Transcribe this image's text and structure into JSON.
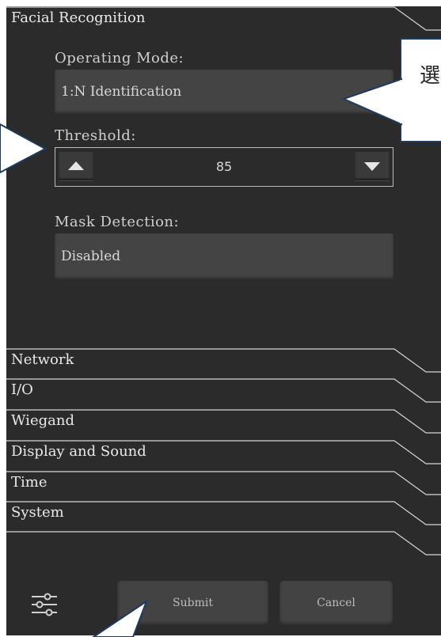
{
  "facial_recognition": {
    "title": "Facial Recognition",
    "operating_mode": {
      "label": "Operating Mode:",
      "value": "1:N Identification"
    },
    "threshold": {
      "label": "Threshold:",
      "value": "85"
    },
    "mask_detection": {
      "label": "Mask Detection:",
      "value": "Disabled"
    }
  },
  "sections": [
    {
      "label": "Network"
    },
    {
      "label": "I/O"
    },
    {
      "label": "Wiegand"
    },
    {
      "label": "Display and Sound"
    },
    {
      "label": "Time"
    },
    {
      "label": "System"
    }
  ],
  "footer": {
    "settings_icon": "sliders-icon",
    "submit_label": "Submit",
    "cancel_label": "Cancel"
  },
  "annotation": {
    "partial_text": "選"
  },
  "colors": {
    "screen_bg": "#2b2b2b",
    "field_bg": "#444444",
    "callout_border": "#1e3b5e"
  }
}
